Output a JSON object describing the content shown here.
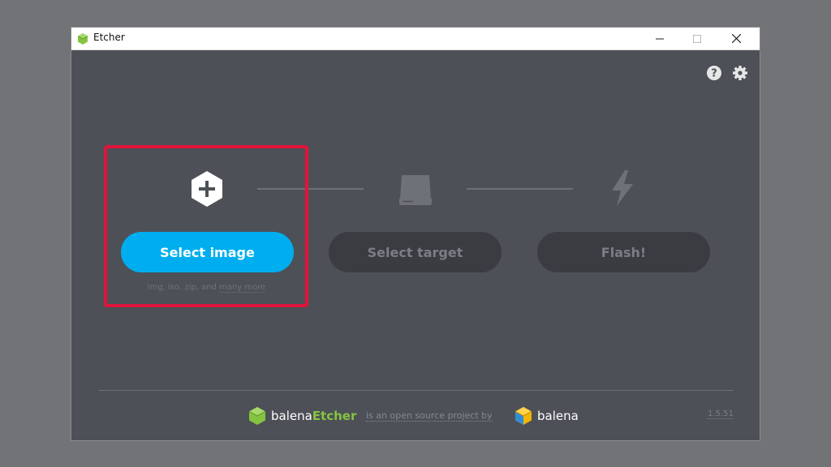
{
  "window": {
    "title": "Etcher"
  },
  "steps": {
    "image": {
      "button": "Select image",
      "formats_prefix": "img, iso, zip, and",
      "formats_link": "many more"
    },
    "target": {
      "button": "Select target"
    },
    "flash": {
      "button": "Flash!"
    }
  },
  "footer": {
    "brand_prefix": "balena",
    "brand_suffix": "Etcher",
    "tagline": "is an open source project by",
    "company": "balena",
    "version": "1.5.51"
  },
  "colors": {
    "background": "#4d5057",
    "primary": "#00aeef",
    "disabled": "#3a3c41",
    "accent_green": "#85c440",
    "highlight": "#e0143c"
  }
}
